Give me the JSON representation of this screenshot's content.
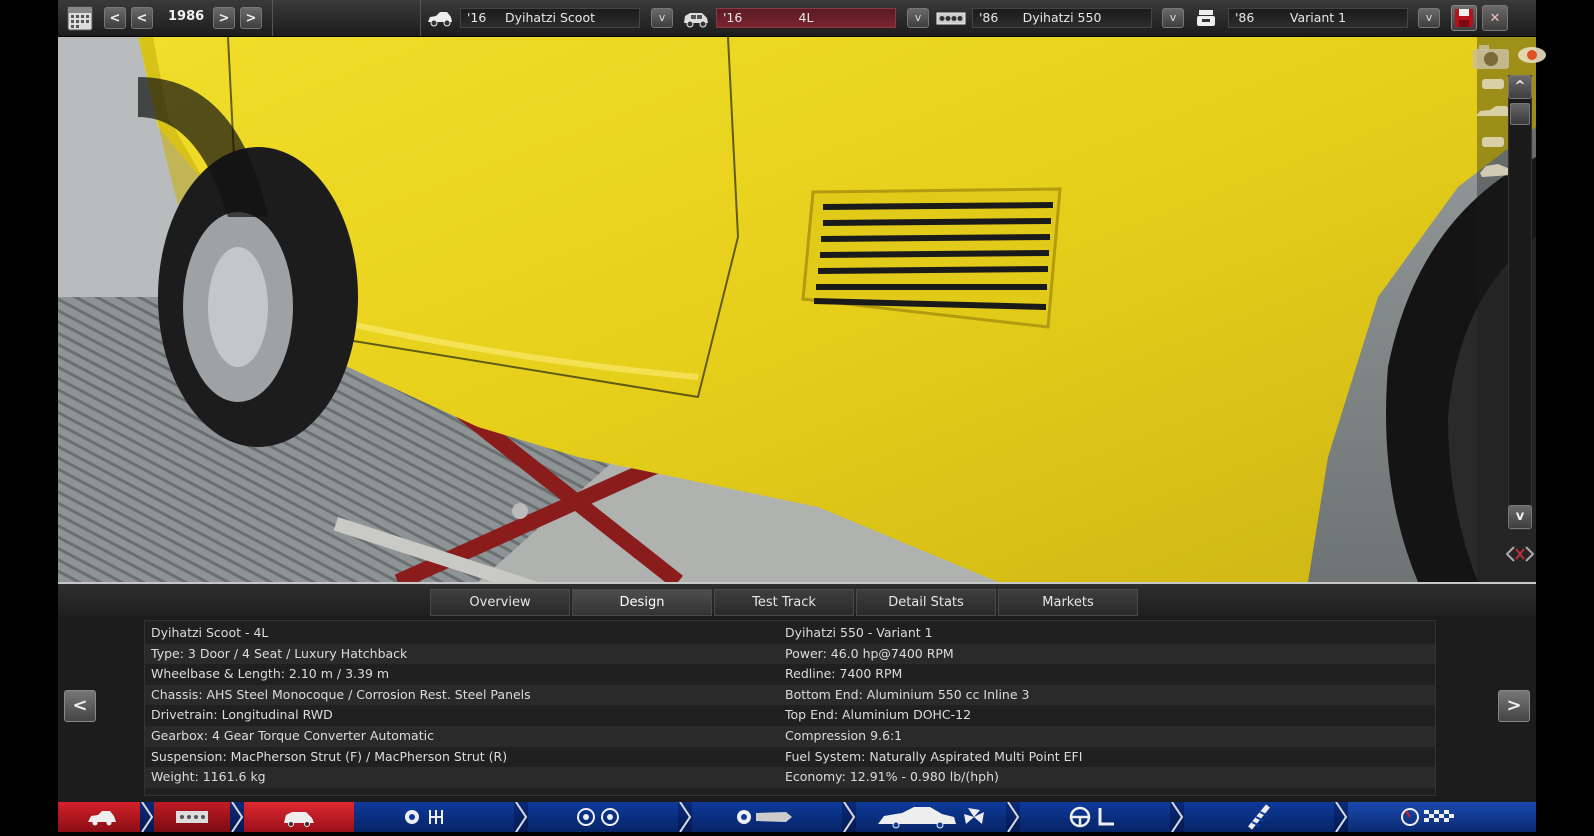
{
  "topbar": {
    "year": "1986",
    "prev_labels": [
      "<",
      "<"
    ],
    "next_labels": [
      ">",
      ">"
    ],
    "model": {
      "year": "'16",
      "name": "Dyihatzi Scoot"
    },
    "trim": {
      "year": "'16",
      "name": "4L"
    },
    "engine": {
      "year": "'86",
      "name": "Dyihatzi 550"
    },
    "variant": {
      "year": "'86",
      "name": "Variant 1"
    },
    "dropdown_label": "v",
    "close_label": "✕"
  },
  "viewtools": {
    "scroll_up": "^",
    "scroll_down": "v",
    "collapse": "<>"
  },
  "tabs": [
    "Overview",
    "Design",
    "Test Track",
    "Detail Stats",
    "Markets"
  ],
  "active_tab": "Design",
  "info": {
    "left": [
      "Dyihatzi Scoot - 4L",
      "Type: 3 Door / 4 Seat / Luxury Hatchback",
      "Wheelbase & Length: 2.10 m / 3.39 m",
      "Chassis: AHS Steel Monocoque / Corrosion Rest. Steel Panels",
      "Drivetrain: Longitudinal RWD",
      "Gearbox: 4 Gear Torque Converter Automatic",
      "Suspension: MacPherson Strut (F) / MacPherson Strut (R)",
      "Weight: 1161.6 kg"
    ],
    "right": [
      "Dyihatzi 550 - Variant 1",
      "Power: 46.0 hp@7400 RPM",
      "Redline: 7400 RPM",
      "Bottom End: Aluminium 550 cc Inline 3",
      "Top End: Aluminium DOHC-12",
      "Compression 9.6:1",
      "Fuel System: Naturally Aspirated Multi Point EFI",
      "Economy: 12.91% - 0.980 lb/(hph)"
    ]
  },
  "side_prev": "<",
  "side_next": ">",
  "colors": {
    "car_body": "#e8d21e",
    "lift": "#8a1c1c",
    "nav_active": "#b5121b",
    "nav_blue": "#0d3a9a"
  },
  "nav_icons": [
    "car-icon",
    "chassis-icon",
    "body-icon",
    "engine-icon",
    "wheels-icon",
    "gearbox-icon",
    "body-profile-icon",
    "steering-icon",
    "suspension-icon",
    "test-flag-icon"
  ]
}
